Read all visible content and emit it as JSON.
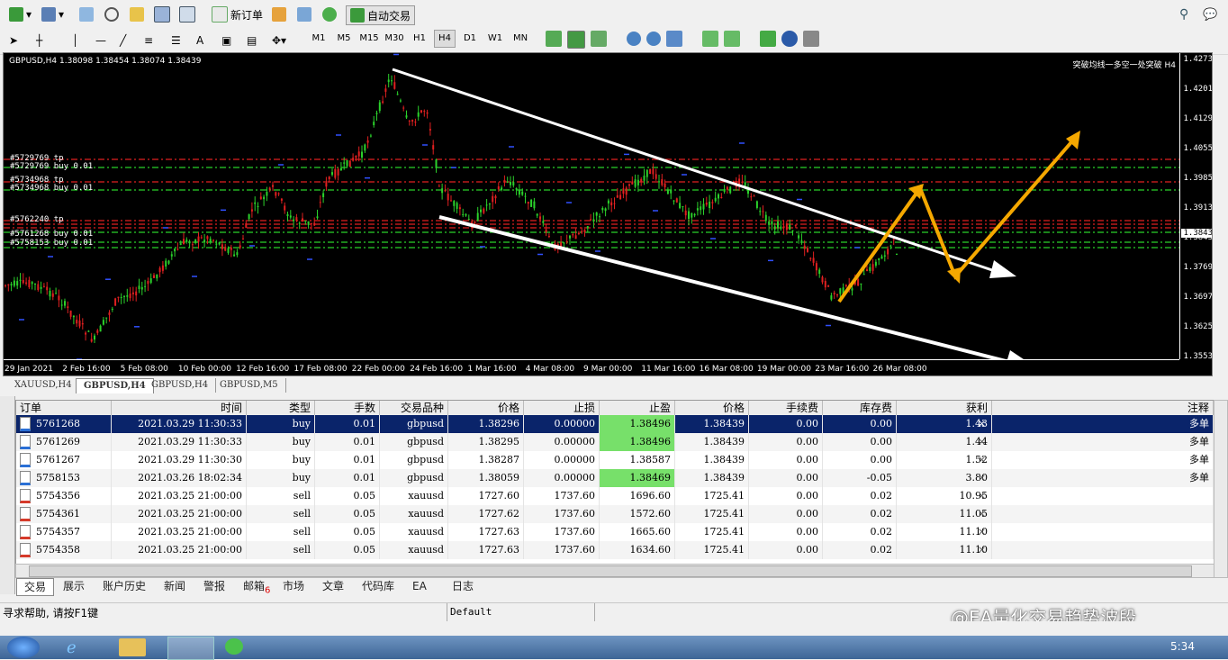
{
  "toolbar": {
    "new_order": "新订单",
    "auto_trade": "自动交易",
    "timeframes": [
      "M1",
      "M5",
      "M15",
      "M30",
      "H1",
      "H4",
      "D1",
      "W1",
      "MN"
    ],
    "active_timeframe": "H4"
  },
  "chart": {
    "symbol_info": "GBPUSD,H4  1.38098 1.38454 1.38074 1.38439",
    "ea_label": "突破均线一多空一处突破 H4",
    "current_price": "1.3843",
    "price_labels": [
      "1.4273",
      "1.4201",
      "1.4129",
      "1.4055",
      "1.3985",
      "1.3913",
      "1.3843",
      "1.3769",
      "1.3697",
      "1.3625",
      "1.3553"
    ],
    "time_labels": [
      "29 Jan 2021",
      "2 Feb 16:00",
      "5 Feb 08:00",
      "10 Feb 00:00",
      "12 Feb 16:00",
      "17 Feb 08:00",
      "22 Feb 00:00",
      "24 Feb 16:00",
      "1 Mar 16:00",
      "4 Mar 08:00",
      "9 Mar 00:00",
      "11 Mar 16:00",
      "16 Mar 08:00",
      "19 Mar 00:00",
      "23 Mar 16:00",
      "26 Mar 08:00"
    ],
    "order_labels": [
      {
        "text": "#5729769 tp"
      },
      {
        "text": "#5729769 buy 0.01"
      },
      {
        "text": "#5734968 tp"
      },
      {
        "text": "#5734968 buy 0.01"
      },
      {
        "text": "#5762240 tp"
      },
      {
        "text": "#5761268 buy 0.01"
      },
      {
        "text": "#5758153 buy 0.01"
      }
    ]
  },
  "chart_tabs": [
    "XAUUSD,H4",
    "GBPUSD,H4",
    "GBPUSD,H4",
    "GBPUSD,M5"
  ],
  "active_chart_tab": 1,
  "table": {
    "headers": [
      "订单",
      "时间",
      "类型",
      "手数",
      "交易品种",
      "价格",
      "止损",
      "止盈",
      "价格",
      "手续费",
      "库存费",
      "获利",
      "注释"
    ],
    "rows": [
      {
        "order": "5761268",
        "time": "2021.03.29 11:30:33",
        "type": "buy",
        "lots": "0.01",
        "symbol": "gbpusd",
        "price": "1.38296",
        "sl": "0.00000",
        "tp": "1.38496",
        "cur": "1.38439",
        "comm": "0.00",
        "swap": "0.00",
        "profit": "1.43",
        "note": "多单",
        "selected": true,
        "tp_green": true
      },
      {
        "order": "5761269",
        "time": "2021.03.29 11:30:33",
        "type": "buy",
        "lots": "0.01",
        "symbol": "gbpusd",
        "price": "1.38295",
        "sl": "0.00000",
        "tp": "1.38496",
        "cur": "1.38439",
        "comm": "0.00",
        "swap": "0.00",
        "profit": "1.44",
        "note": "多单",
        "selected": false,
        "tp_green": true
      },
      {
        "order": "5761267",
        "time": "2021.03.29 11:30:30",
        "type": "buy",
        "lots": "0.01",
        "symbol": "gbpusd",
        "price": "1.38287",
        "sl": "0.00000",
        "tp": "1.38587",
        "cur": "1.38439",
        "comm": "0.00",
        "swap": "0.00",
        "profit": "1.52",
        "note": "多单",
        "selected": false,
        "tp_green": false
      },
      {
        "order": "5758153",
        "time": "2021.03.26 18:02:34",
        "type": "buy",
        "lots": "0.01",
        "symbol": "gbpusd",
        "price": "1.38059",
        "sl": "0.00000",
        "tp": "1.38469",
        "cur": "1.38439",
        "comm": "0.00",
        "swap": "-0.05",
        "profit": "3.80",
        "note": "多单",
        "selected": false,
        "tp_green": true
      },
      {
        "order": "5754356",
        "time": "2021.03.25 21:00:00",
        "type": "sell",
        "lots": "0.05",
        "symbol": "xauusd",
        "price": "1727.60",
        "sl": "1737.60",
        "tp": "1696.60",
        "cur": "1725.41",
        "comm": "0.00",
        "swap": "0.02",
        "profit": "10.95",
        "note": "",
        "selected": false,
        "tp_green": false
      },
      {
        "order": "5754361",
        "time": "2021.03.25 21:00:00",
        "type": "sell",
        "lots": "0.05",
        "symbol": "xauusd",
        "price": "1727.62",
        "sl": "1737.60",
        "tp": "1572.60",
        "cur": "1725.41",
        "comm": "0.00",
        "swap": "0.02",
        "profit": "11.05",
        "note": "",
        "selected": false,
        "tp_green": false
      },
      {
        "order": "5754357",
        "time": "2021.03.25 21:00:00",
        "type": "sell",
        "lots": "0.05",
        "symbol": "xauusd",
        "price": "1727.63",
        "sl": "1737.60",
        "tp": "1665.60",
        "cur": "1725.41",
        "comm": "0.00",
        "swap": "0.02",
        "profit": "11.10",
        "note": "",
        "selected": false,
        "tp_green": false
      },
      {
        "order": "5754358",
        "time": "2021.03.25 21:00:00",
        "type": "sell",
        "lots": "0.05",
        "symbol": "xauusd",
        "price": "1727.63",
        "sl": "1737.60",
        "tp": "1634.60",
        "cur": "1725.41",
        "comm": "0.00",
        "swap": "0.02",
        "profit": "11.10",
        "note": "",
        "selected": false,
        "tp_green": false
      }
    ]
  },
  "bottom_tabs": [
    "交易",
    "展示",
    "账户历史",
    "新闻",
    "警报",
    "邮箱",
    "市场",
    "文章",
    "代码库",
    "EA",
    "日志"
  ],
  "mail_badge": "6",
  "status": {
    "help": "寻求帮助, 请按F1键",
    "profile": "Default",
    "watermark": "@EA量化交易趋势波段"
  },
  "taskbar": {
    "clock": "5:34"
  },
  "colors": {
    "bull": "#2bd12b",
    "bear": "#e02020",
    "selected_row": "#0a246a",
    "tp_green": "#77e06a",
    "arrow": "#f5a800"
  }
}
